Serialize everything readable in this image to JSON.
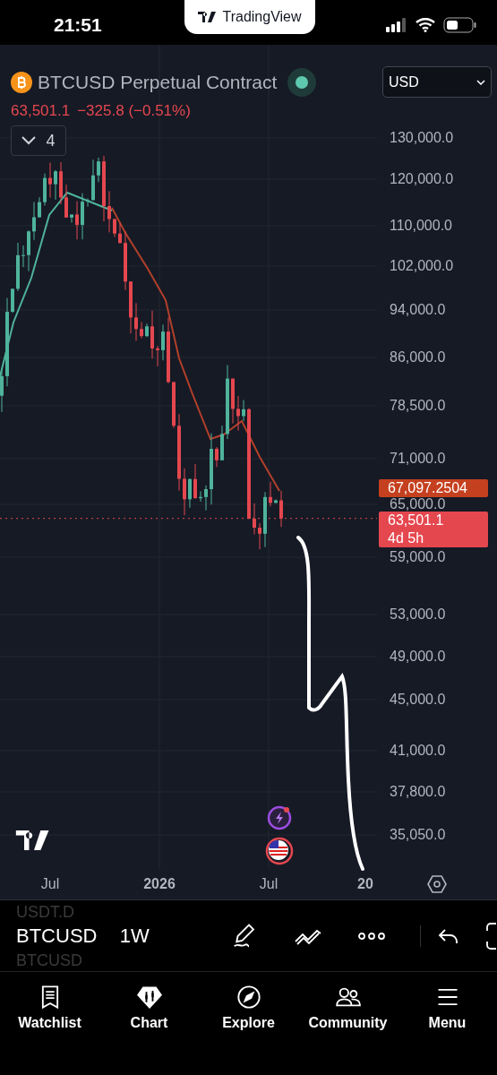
{
  "status_bar": {
    "time": "21:51",
    "app_banner": "TradingView"
  },
  "chart": {
    "symbol_title": "BTCUSD Perpetual Contract",
    "last_price": "63,501.1",
    "change": "−325.8 (−0.51%)",
    "indicators_count": "4",
    "currency": "USD",
    "price_ticks": [
      "130,000.0",
      "120,000.0",
      "110,000.0",
      "102,000.0",
      "94,000.0",
      "86,000.0",
      "78,500.0",
      "71,000.0",
      "65,000.0",
      "59,000.0",
      "53,000.0",
      "49,000.0",
      "45,000.0",
      "41,000.0",
      "37,800.0",
      "35,050.0"
    ],
    "price_labels": [
      {
        "kind": "average",
        "text": "67,097.2504"
      },
      {
        "kind": "last",
        "text": "63,501.1",
        "countdown": "4d 5h"
      }
    ],
    "time_ticks": [
      {
        "label": "Jul",
        "bold": false
      },
      {
        "label": "2026",
        "bold": true
      },
      {
        "label": "Jul",
        "bold": false
      },
      {
        "label": "20",
        "bold": true
      }
    ]
  },
  "toolbar": {
    "symbol_above": "USDT.D",
    "symbol": "BTCUSD",
    "symbol_below": "BTCUSD",
    "interval": "1W"
  },
  "bottom_nav": [
    {
      "label": "Watchlist",
      "kind": "watchlist"
    },
    {
      "label": "Chart",
      "kind": "chart"
    },
    {
      "label": "Explore",
      "kind": "explore"
    },
    {
      "label": "Community",
      "kind": "community"
    },
    {
      "label": "Menu",
      "kind": "menu"
    }
  ]
}
